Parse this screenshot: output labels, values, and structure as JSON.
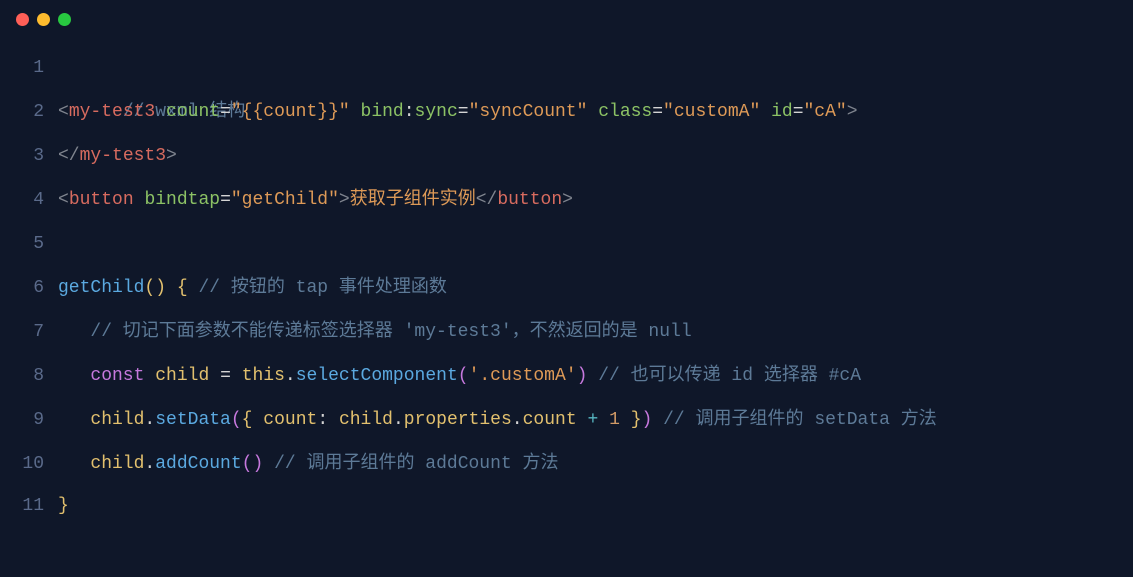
{
  "window": {
    "traffic": {
      "close_color": "#ff5f57",
      "minimize_color": "#febc2e",
      "maximize_color": "#28c840"
    }
  },
  "code": {
    "line_numbers": [
      "1",
      "2",
      "3",
      "4",
      "5",
      "6",
      "7",
      "8",
      "9",
      "10",
      "11"
    ],
    "l1": {
      "t1": "// wxml 结构"
    },
    "l2": {
      "open": "<",
      "tag": "my-test3",
      "sp": " ",
      "a1n": "count",
      "eq": "=",
      "a1v": "\"{{count}}\"",
      "a2n": "bind",
      "colon": ":",
      "a2n2": "sync",
      "a2v": "\"syncCount\"",
      "a3n": "class",
      "a3v": "\"customA\"",
      "a4n": "id",
      "a4v": "\"cA\"",
      "close": ">"
    },
    "l3": {
      "open": "</",
      "tag": "my-test3",
      "close": ">"
    },
    "l4": {
      "open": "<",
      "tag": "button",
      "sp": " ",
      "a1n": "bindtap",
      "eq": "=",
      "a1v": "\"getChild\"",
      "close1": ">",
      "text": "获取子组件实例",
      "open2": "</",
      "tag2": "button",
      "close2": ">"
    },
    "l6": {
      "fn": "getChild",
      "paren": "()",
      "sp": " ",
      "brace": "{",
      "sp2": " ",
      "cm": "// 按钮的 tap 事件处理函数"
    },
    "l7": {
      "indent": "   ",
      "cm": "// 切记下面参数不能传递标签选择器 'my-test3'，不然返回的是 null"
    },
    "l8": {
      "indent": "   ",
      "kw": "const",
      "sp": " ",
      "var": "child",
      "sp2": " ",
      "eq": "=",
      "sp3": " ",
      "this": "this",
      "dot": ".",
      "method": "selectComponent",
      "paren_l": "(",
      "arg": "'.customA'",
      "paren_r": ")",
      "sp4": " ",
      "cm": "// 也可以传递 id 选择器 #cA"
    },
    "l9": {
      "indent": "   ",
      "obj": "child",
      "dot": ".",
      "method": "setData",
      "paren_l": "(",
      "brace_l": "{",
      "sp": " ",
      "key": "count",
      "colon": ":",
      "sp2": " ",
      "obj2": "child",
      "dot2": ".",
      "prop": "properties",
      "dot3": ".",
      "prop2": "count",
      "sp3": " ",
      "op": "+",
      "sp4": " ",
      "num": "1",
      "sp5": " ",
      "brace_r": "}",
      "paren_r": ")",
      "sp6": " ",
      "cm": "// 调用子组件的 setData 方法"
    },
    "l10": {
      "indent": "   ",
      "obj": "child",
      "dot": ".",
      "method": "addCount",
      "paren": "()",
      "sp": " ",
      "cm": "// 调用子组件的 addCount 方法"
    },
    "l11": {
      "brace": "}"
    }
  }
}
